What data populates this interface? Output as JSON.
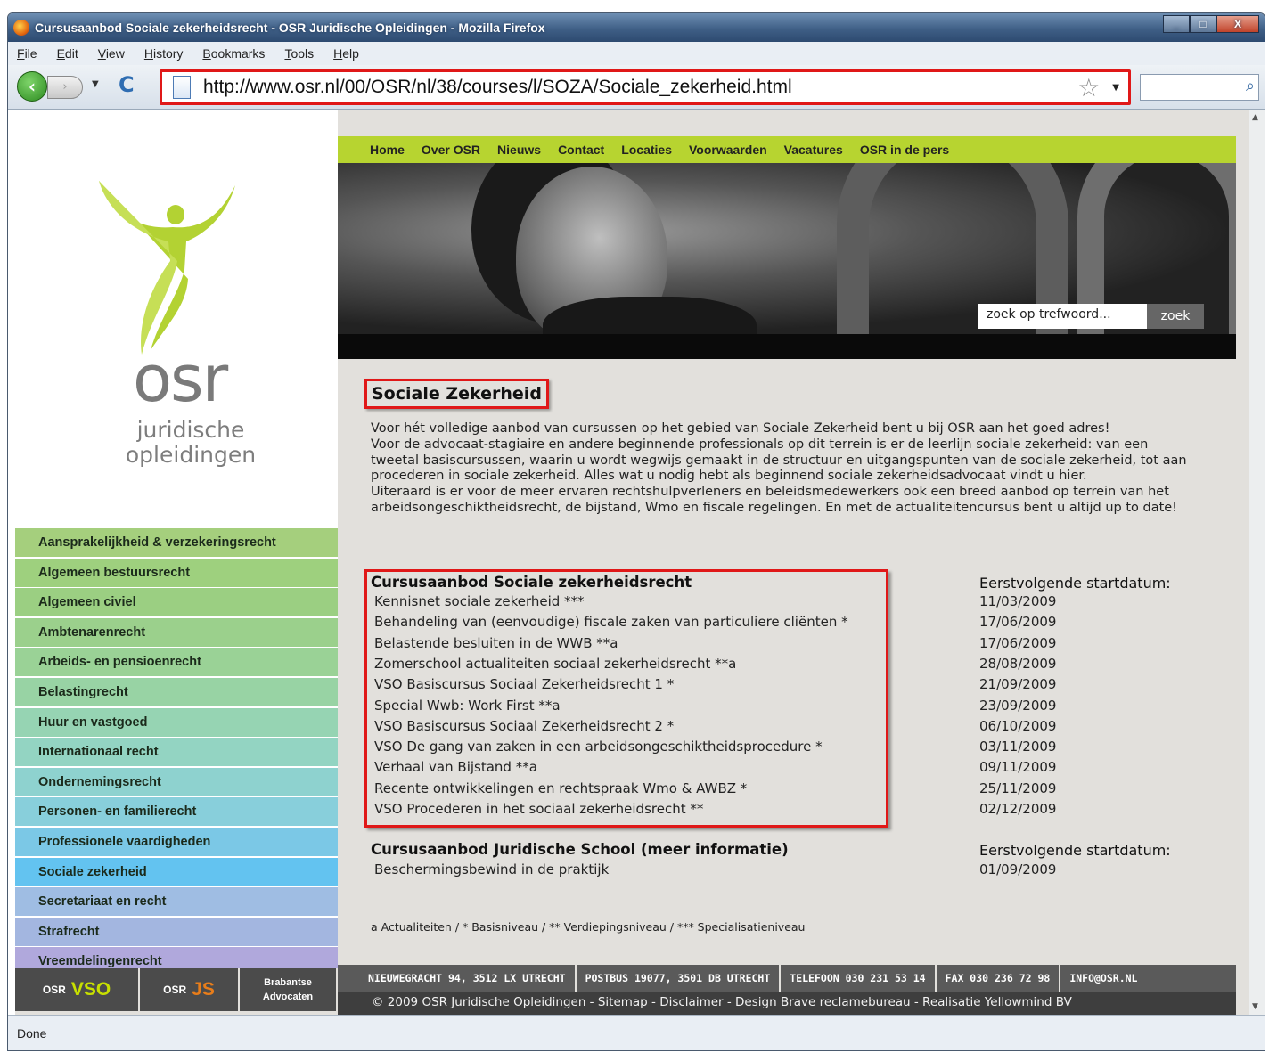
{
  "window": {
    "title": "Cursusaanbod Sociale zekerheidsrecht - OSR Juridische Opleidingen - Mozilla Firefox",
    "minimize": "_",
    "maximize": "□",
    "close": "X"
  },
  "menu": [
    "File",
    "Edit",
    "View",
    "History",
    "Bookmarks",
    "Tools",
    "Help"
  ],
  "toolbar": {
    "back": "‹",
    "forward": "›",
    "reload": "C",
    "url": "http://www.osr.nl/00/OSR/nl/38/courses/l/SOZA/Sociale_zekerheid.html",
    "star": "☆"
  },
  "status": "Done",
  "logo": {
    "brand": "osr",
    "sub1": "juridische",
    "sub2": "opleidingen",
    "accent": "#b3d233"
  },
  "topnav": [
    "Home",
    "Over OSR",
    "Nieuws",
    "Contact",
    "Locaties",
    "Voorwaarden",
    "Vacatures",
    "OSR in de pers"
  ],
  "search": {
    "placeholder": "zoek op trefwoord...",
    "button": "zoek"
  },
  "categories": [
    {
      "label": "Aansprakelijkheid & verzekeringsrecht",
      "color": "#a5cf7d"
    },
    {
      "label": "Algemeen bestuursrecht",
      "color": "#9ed07e"
    },
    {
      "label": "Algemeen civiel",
      "color": "#9bcf82"
    },
    {
      "label": "Ambtenarenrecht",
      "color": "#9bd08c"
    },
    {
      "label": "Arbeids- en pensioenrecht",
      "color": "#9ad296"
    },
    {
      "label": "Belastingrecht",
      "color": "#98d3a4"
    },
    {
      "label": "Huur en vastgoed",
      "color": "#96d4b3"
    },
    {
      "label": "Internationaal recht",
      "color": "#93d4c2"
    },
    {
      "label": "Ondernemingsrecht",
      "color": "#8ed2cf"
    },
    {
      "label": "Personen- en familierecht",
      "color": "#88cfdb"
    },
    {
      "label": "Professionele vaardigheden",
      "color": "#7bc8e6"
    },
    {
      "label": "Sociale zekerheid",
      "color": "#63c3f0",
      "active": true
    },
    {
      "label": "Secretariaat en recht",
      "color": "#9fbde3"
    },
    {
      "label": "Strafrecht",
      "color": "#a3b6e0"
    },
    {
      "label": "Vreemdelingenrecht",
      "color": "#b0a8dc"
    }
  ],
  "bottom_logos": {
    "vso_prefix": "OSR",
    "vso": "VSO",
    "js_prefix": "OSR",
    "js": "JS",
    "brabantse1": "Brabantse",
    "brabantse2": "Advocaten"
  },
  "main": {
    "title": "Sociale Zekerheid",
    "intro": [
      "Voor hét volledige aanbod van cursussen op het gebied van Sociale Zekerheid bent u bij OSR aan het goed adres!",
      "Voor de advocaat-stagiaire en andere beginnende professionals op dit terrein is er de leerlijn sociale zekerheid: van een tweetal basiscursussen, waarin u wordt wegwijs gemaakt in de structuur en uitgangspunten van de sociale zekerheid, tot aan procederen in sociale zekerheid. Alles wat u nodig hebt als beginnend sociale zekerheidsadvocaat vindt u hier.",
      "Uiteraard is er voor de meer ervaren rechtshulpverleners en beleidsmedewerkers ook een breed aanbod op terrein van het arbeidsongeschiktheidsrecht, de bijstand, Wmo en fiscale regelingen. En met de actualiteitencursus bent u altijd up to date!"
    ],
    "section1": {
      "heading": "Cursusaanbod Sociale zekerheidsrecht",
      "date_heading": "Eerstvolgende startdatum:",
      "courses": [
        {
          "name": "Kennisnet sociale zekerheid ***",
          "date": "11/03/2009"
        },
        {
          "name": "Behandeling van (eenvoudige) fiscale zaken van particuliere cliënten *",
          "date": "17/06/2009"
        },
        {
          "name": "Belastende besluiten in de WWB **a",
          "date": "17/06/2009"
        },
        {
          "name": "Zomerschool actualiteiten sociaal zekerheidsrecht **a",
          "date": "28/08/2009"
        },
        {
          "name": "VSO Basiscursus Sociaal Zekerheidsrecht 1 *",
          "date": "21/09/2009"
        },
        {
          "name": "Special Wwb: Work First **a",
          "date": "23/09/2009"
        },
        {
          "name": "VSO Basiscursus Sociaal Zekerheidsrecht 2 *",
          "date": "06/10/2009"
        },
        {
          "name": "VSO De gang van zaken in een arbeidsongeschiktheidsprocedure *",
          "date": "03/11/2009"
        },
        {
          "name": "Verhaal van Bijstand **a",
          "date": "09/11/2009"
        },
        {
          "name": "Recente ontwikkelingen en rechtspraak Wmo & AWBZ *",
          "date": "25/11/2009"
        },
        {
          "name": "VSO Procederen in het sociaal zekerheidsrecht **",
          "date": "02/12/2009"
        }
      ]
    },
    "section2": {
      "heading": "Cursusaanbod Juridische School (meer informatie)",
      "date_heading": "Eerstvolgende startdatum:",
      "courses": [
        {
          "name": "Beschermingsbewind in de praktijk",
          "date": "01/09/2009"
        }
      ]
    },
    "legend": "a Actualiteiten / * Basisniveau / ** Verdiepingsniveau / *** Specialisatieniveau"
  },
  "footer": {
    "items": [
      "NIEUWEGRACHT 94, 3512 LX UTRECHT",
      "POSTBUS 19077, 3501 DB UTRECHT",
      "TELEFOON 030 231 53 14",
      "FAX 030 236 72 98",
      "INFO@OSR.NL"
    ],
    "copyright": "© 2009 OSR Juridische Opleidingen - Sitemap - Disclaimer - Design Brave reclamebureau - Realisatie Yellowmind BV"
  },
  "colors": {
    "nav_green": "#b7d430",
    "highlight_red": "#e01818",
    "content_bg": "#e2e0dc"
  }
}
